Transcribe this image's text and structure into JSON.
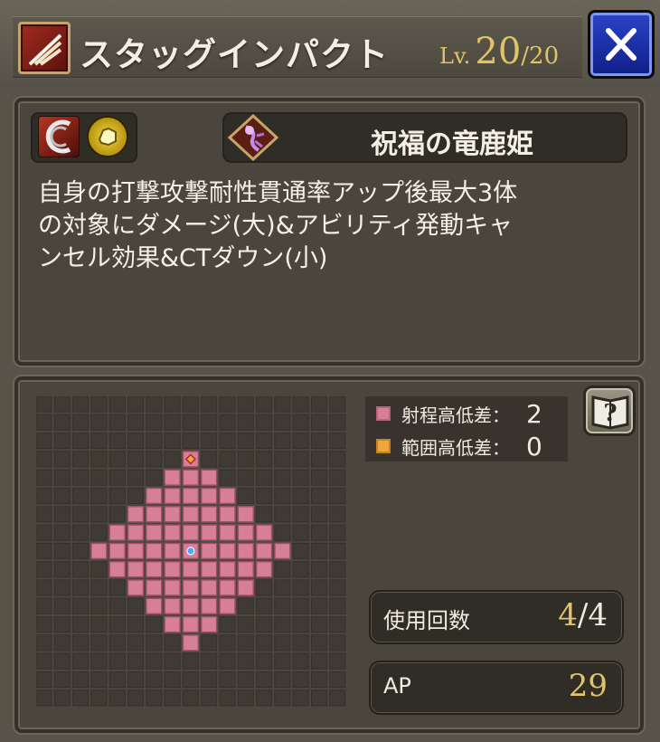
{
  "header": {
    "skill_icon": "slash-skill-icon",
    "skill_name": "スタッグインパクト",
    "level_prefix": "Lv.",
    "level_current": "20",
    "level_separator": "/",
    "level_max": "20",
    "close_icon": "close-x-icon"
  },
  "info": {
    "attribute_icons": [
      "slash-attack-icon",
      "light-element-icon"
    ],
    "unit_icon": "dragon-deer-emblem-icon",
    "unit_name": "祝福の竜鹿姫",
    "description_lines": [
      "自身の打撃攻撃耐性貫通率アップ後最大3体",
      "の対象にダメージ(大)&アビリティ発動キャ",
      "ンセル効果&CTダウン(小)"
    ]
  },
  "range": {
    "grid_size": 17,
    "legend": {
      "range_label": "射程高低差：",
      "range_value": "2",
      "area_label": "範囲高低差：",
      "area_value": "0"
    },
    "help_icon": "help-book-icon",
    "uses": {
      "label": "使用回数",
      "current": "4",
      "separator": "/",
      "max": "4"
    },
    "ap": {
      "label": "AP",
      "value": "29"
    }
  },
  "colors": {
    "range_cell": "#d87f98",
    "area_cell": "#f0a53a",
    "center_cell": "#4aa8ff",
    "gold_text": "#e2c468"
  }
}
